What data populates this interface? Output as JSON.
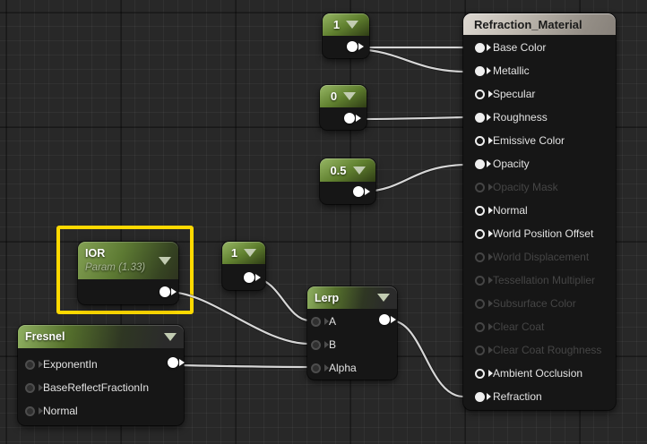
{
  "editor": {
    "background_color": "#282828",
    "wire_color": "#d6d6d6",
    "highlight_color": "#ffd900",
    "node_header_green": "#7fa04d",
    "material_header_color": "#d3cdc5"
  },
  "nodes": {
    "const_one_top": {
      "type": "constant",
      "value": "1"
    },
    "const_zero": {
      "type": "constant",
      "value": "0"
    },
    "const_half": {
      "type": "constant",
      "value": "0.5"
    },
    "ior": {
      "type": "scalar-parameter",
      "title": "IOR",
      "subtitle": "Param (1.33)",
      "highlighted": true
    },
    "const_one_small": {
      "type": "constant",
      "value": "1"
    },
    "lerp": {
      "title": "Lerp",
      "inputs": [
        {
          "label": "A"
        },
        {
          "label": "B"
        },
        {
          "label": "Alpha"
        }
      ]
    },
    "fresnel": {
      "title": "Fresnel",
      "inputs": [
        {
          "label": "ExponentIn"
        },
        {
          "label": "BaseReflectFractionIn"
        },
        {
          "label": "Normal"
        }
      ]
    },
    "material": {
      "title": "Refraction_Material",
      "pins": [
        {
          "label": "Base Color",
          "state": "connected"
        },
        {
          "label": "Metallic",
          "state": "connected"
        },
        {
          "label": "Specular",
          "state": "hollow"
        },
        {
          "label": "Roughness",
          "state": "connected"
        },
        {
          "label": "Emissive Color",
          "state": "hollow"
        },
        {
          "label": "Opacity",
          "state": "connected"
        },
        {
          "label": "Opacity Mask",
          "state": "disabled"
        },
        {
          "label": "Normal",
          "state": "hollow"
        },
        {
          "label": "World Position Offset",
          "state": "hollow"
        },
        {
          "label": "World Displacement",
          "state": "disabled"
        },
        {
          "label": "Tessellation Multiplier",
          "state": "disabled"
        },
        {
          "label": "Subsurface Color",
          "state": "disabled"
        },
        {
          "label": "Clear Coat",
          "state": "disabled"
        },
        {
          "label": "Clear Coat Roughness",
          "state": "disabled"
        },
        {
          "label": "Ambient Occlusion",
          "state": "hollow"
        },
        {
          "label": "Refraction",
          "state": "connected"
        }
      ]
    }
  },
  "wires": [
    {
      "from": "const_one_top.output",
      "to": "material.Base Color"
    },
    {
      "from": "const_one_top.output",
      "to": "material.Metallic"
    },
    {
      "from": "const_zero.output",
      "to": "material.Roughness"
    },
    {
      "from": "const_half.output",
      "to": "material.Opacity"
    },
    {
      "from": "ior.output",
      "to": "lerp.B"
    },
    {
      "from": "const_one_small.output",
      "to": "lerp.A"
    },
    {
      "from": "fresnel.output",
      "to": "lerp.Alpha"
    },
    {
      "from": "lerp.output",
      "to": "material.Refraction"
    }
  ]
}
